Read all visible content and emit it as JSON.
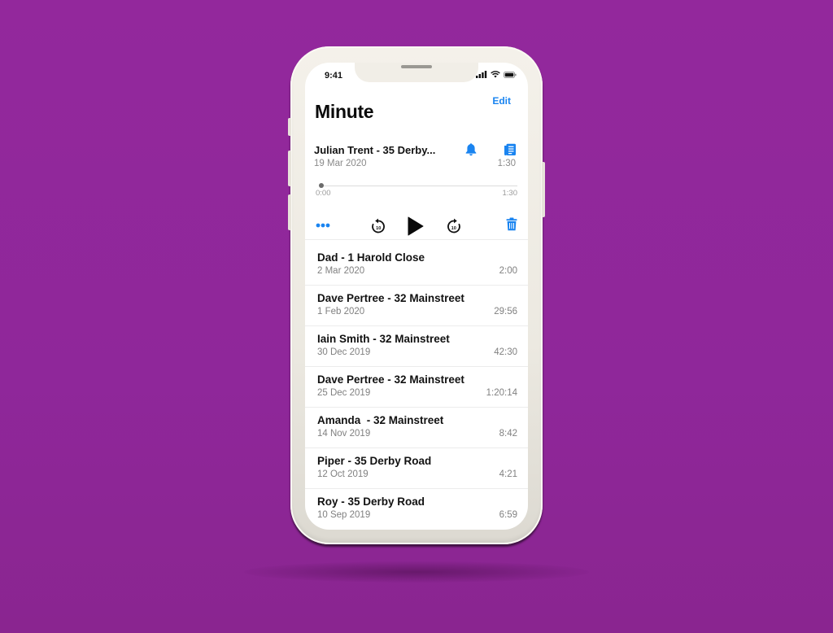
{
  "colors": {
    "background": "#93289c",
    "accent": "#1a84f0",
    "text_primary": "#111111",
    "text_secondary": "#808080"
  },
  "status_bar": {
    "time": "9:41",
    "icons": [
      "cellular-signal-icon",
      "wifi-icon",
      "battery-icon"
    ]
  },
  "header": {
    "edit_label": "Edit",
    "title": "Minute"
  },
  "current_recording": {
    "title": "Julian Trent - 35 Derby...",
    "date": "19 Mar 2020",
    "duration": "1:30",
    "icons": [
      "bell-icon",
      "transcript-icon"
    ],
    "progress": {
      "position": "0:00",
      "length": "1:30",
      "fraction": 0.0
    },
    "controls": {
      "more": "more-icon",
      "skip_back_seconds": "10",
      "play": "play-icon",
      "skip_forward_seconds": "10",
      "delete": "trash-icon"
    }
  },
  "recordings": [
    {
      "title": "Dad - 1 Harold Close",
      "date": "2 Mar 2020",
      "duration": "2:00"
    },
    {
      "title": "Dave Pertree - 32 Mainstreet",
      "date": "1 Feb 2020",
      "duration": "29:56"
    },
    {
      "title": "Iain Smith - 32 Mainstreet",
      "date": "30 Dec 2019",
      "duration": "42:30"
    },
    {
      "title": "Dave Pertree - 32 Mainstreet",
      "date": "25 Dec 2019",
      "duration": "1:20:14"
    },
    {
      "title": "Amanda  - 32 Mainstreet",
      "date": "14 Nov 2019",
      "duration": "8:42"
    },
    {
      "title": "Piper - 35 Derby Road",
      "date": "12 Oct 2019",
      "duration": "4:21"
    },
    {
      "title": "Roy - 35 Derby Road",
      "date": "10 Sep 2019",
      "duration": "6:59"
    }
  ]
}
